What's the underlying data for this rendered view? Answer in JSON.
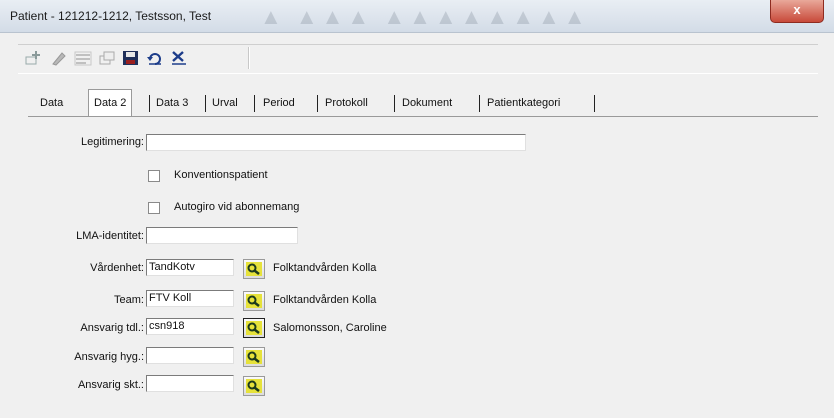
{
  "window": {
    "title": "Patient - 121212-1212, Testsson, Test",
    "close_label": "x"
  },
  "toolbar": {
    "buttons": [
      {
        "icon": "add-icon"
      },
      {
        "icon": "edit-icon"
      },
      {
        "icon": "list-icon"
      },
      {
        "icon": "copy-icon"
      },
      {
        "icon": "save-icon"
      },
      {
        "icon": "undo-icon"
      },
      {
        "icon": "delete-icon"
      }
    ]
  },
  "tabs": [
    {
      "label": "Data"
    },
    {
      "label": "Data 2",
      "active": true
    },
    {
      "label": "Data 3"
    },
    {
      "label": "Urval"
    },
    {
      "label": "Period"
    },
    {
      "label": "Protokoll"
    },
    {
      "label": "Dokument"
    },
    {
      "label": "Patientkategori"
    }
  ],
  "form": {
    "legitimering": {
      "label": "Legitimering:",
      "value": ""
    },
    "konventionspatient": {
      "label": "Konventionspatient",
      "checked": false
    },
    "autogiro": {
      "label": "Autogiro vid abonnemang",
      "checked": false
    },
    "lma": {
      "label": "LMA-identitet:",
      "value": ""
    },
    "vardenhet": {
      "label": "Vårdenhet:",
      "value": "TandKotv",
      "desc": "Folktandvården Kolla"
    },
    "team": {
      "label": "Team:",
      "value": "FTV Koll",
      "desc": "Folktandvården Kolla"
    },
    "ansvarig_tdl": {
      "label": "Ansvarig tdl.:",
      "value": "csn918",
      "desc": "Salomonsson, Caroline"
    },
    "ansvarig_hyg": {
      "label": "Ansvarig hyg.:",
      "value": "",
      "desc": ""
    },
    "ansvarig_skt": {
      "label": "Ansvarig skt.:",
      "value": "",
      "desc": ""
    }
  }
}
